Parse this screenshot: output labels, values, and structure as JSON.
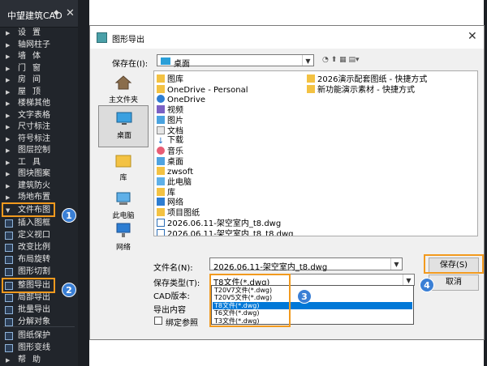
{
  "sidebar": {
    "title": "中望建筑CAD",
    "pin_glyph": "◆",
    "close_glyph": "✕",
    "menu": [
      {
        "label": "设置"
      },
      {
        "label": "轴网柱子"
      },
      {
        "label": "墙体"
      },
      {
        "label": "门窗"
      },
      {
        "label": "房间"
      },
      {
        "label": "屋顶"
      },
      {
        "label": "楼梯其他"
      },
      {
        "label": "文字表格"
      },
      {
        "label": "尺寸标注"
      },
      {
        "label": "符号标注"
      },
      {
        "label": "图层控制"
      },
      {
        "label": "工具"
      },
      {
        "label": "图块图案"
      },
      {
        "label": "建筑防火"
      },
      {
        "label": "场地布置"
      },
      {
        "label": "文件布图"
      }
    ],
    "sub_items": [
      {
        "label": "插入图框"
      },
      {
        "label": "定义视口"
      },
      {
        "label": "改变比例"
      },
      {
        "label": "布局旋转"
      },
      {
        "label": "图形切割"
      },
      {
        "label": "整图导出"
      },
      {
        "label": "局部导出"
      },
      {
        "label": "批量导出"
      },
      {
        "label": "分解对象"
      },
      {
        "label": "图纸保护"
      },
      {
        "label": "图形变线"
      }
    ],
    "help": {
      "label": "帮助"
    }
  },
  "badges": [
    "1",
    "2",
    "3",
    "4"
  ],
  "dialog": {
    "title": "图形导出",
    "save_in_label": "保存在(I):",
    "save_in_value": "桌面",
    "toolbar_glyphs": "◔ ⬆ ▦ ▤▾",
    "places": [
      {
        "label": "主文件夹",
        "icon": "home-icon"
      },
      {
        "label": "桌面",
        "icon": "desktop-icon"
      },
      {
        "label": "库",
        "icon": "library-icon"
      },
      {
        "label": "此电脑",
        "icon": "computer-icon"
      },
      {
        "label": "网络",
        "icon": "network-icon"
      }
    ],
    "files_col1": [
      {
        "name": "图库",
        "icon": "folder"
      },
      {
        "name": "OneDrive - Personal",
        "icon": "folder"
      },
      {
        "name": "OneDrive",
        "icon": "cloud"
      },
      {
        "name": "视频",
        "icon": "vid"
      },
      {
        "name": "图片",
        "icon": "img"
      },
      {
        "name": "文档",
        "icon": "doc"
      },
      {
        "name": "下载",
        "icon": "down"
      },
      {
        "name": "音乐",
        "icon": "music"
      },
      {
        "name": "桌面",
        "icon": "desk"
      },
      {
        "name": "zwsoft",
        "icon": "folder"
      },
      {
        "name": "此电脑",
        "icon": "pc"
      },
      {
        "name": "库",
        "icon": "folder"
      },
      {
        "name": "网络",
        "icon": "net"
      },
      {
        "name": "项目图纸",
        "icon": "folder"
      },
      {
        "name": "2026.06.11-架空室内_t8.dwg",
        "icon": "dwg"
      },
      {
        "name": "2026.06.11-架空室内_t8_t8.dwg",
        "icon": "dwg"
      }
    ],
    "files_col2": [
      {
        "name": "2026演示配套图纸 - 快捷方式",
        "icon": "folder"
      },
      {
        "name": "新功能演示素材 - 快捷方式",
        "icon": "folder"
      }
    ],
    "file_name_label": "文件名(N):",
    "file_name_value": "2026.06.11-架空室内_t8.dwg",
    "file_type_label": "保存类型(T):",
    "file_type_value": "T8文件(*.dwg)",
    "cad_version_label": "CAD版本:",
    "export_content_label": "导出内容",
    "bind_xref_label": "绑定参照",
    "save_button": "保存(S)",
    "cancel_button": "取消",
    "type_options": [
      {
        "label": "T20V7文件(*.dwg)",
        "selected": false
      },
      {
        "label": "T20V5文件(*.dwg)",
        "selected": false
      },
      {
        "label": "T8文件(*.dwg)",
        "selected": true
      },
      {
        "label": "T6文件(*.dwg)",
        "selected": false
      },
      {
        "label": "T3文件(*.dwg)",
        "selected": false
      }
    ]
  },
  "colors": {
    "highlight": "#f29a1e",
    "badge": "#3a7fd5",
    "selection": "#0078d7"
  }
}
